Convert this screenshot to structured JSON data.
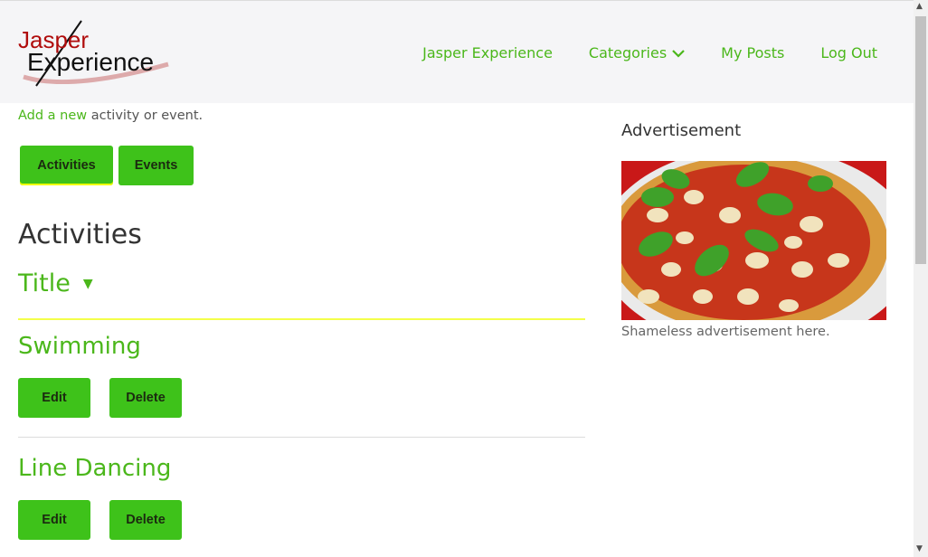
{
  "brand": {
    "line1": "Jasper",
    "line2": "Experience"
  },
  "nav": {
    "home": "Jasper Experience",
    "categories": "Categories",
    "my_posts": "My Posts",
    "logout": "Log Out"
  },
  "intro": {
    "link": "Add a new",
    "rest": " activity or event."
  },
  "tabs": {
    "activities": "Activities",
    "events": "Events"
  },
  "section": {
    "heading": "Activities",
    "sort_label": "Title",
    "sort_icon": "▼"
  },
  "items": [
    {
      "name": "Swimming",
      "edit": "Edit",
      "delete": "Delete"
    },
    {
      "name": "Line Dancing",
      "edit": "Edit",
      "delete": "Delete"
    }
  ],
  "sidebar": {
    "title": "Advertisement",
    "caption": "Shameless advertisement here."
  },
  "colors": {
    "accent": "#4bb71b",
    "button": "#3ec21a",
    "header_bg": "#f5f5f7",
    "highlight": "#f4ff4a"
  },
  "icons": {
    "categories": "chevron-down-icon",
    "sort": "caret-down-icon"
  }
}
